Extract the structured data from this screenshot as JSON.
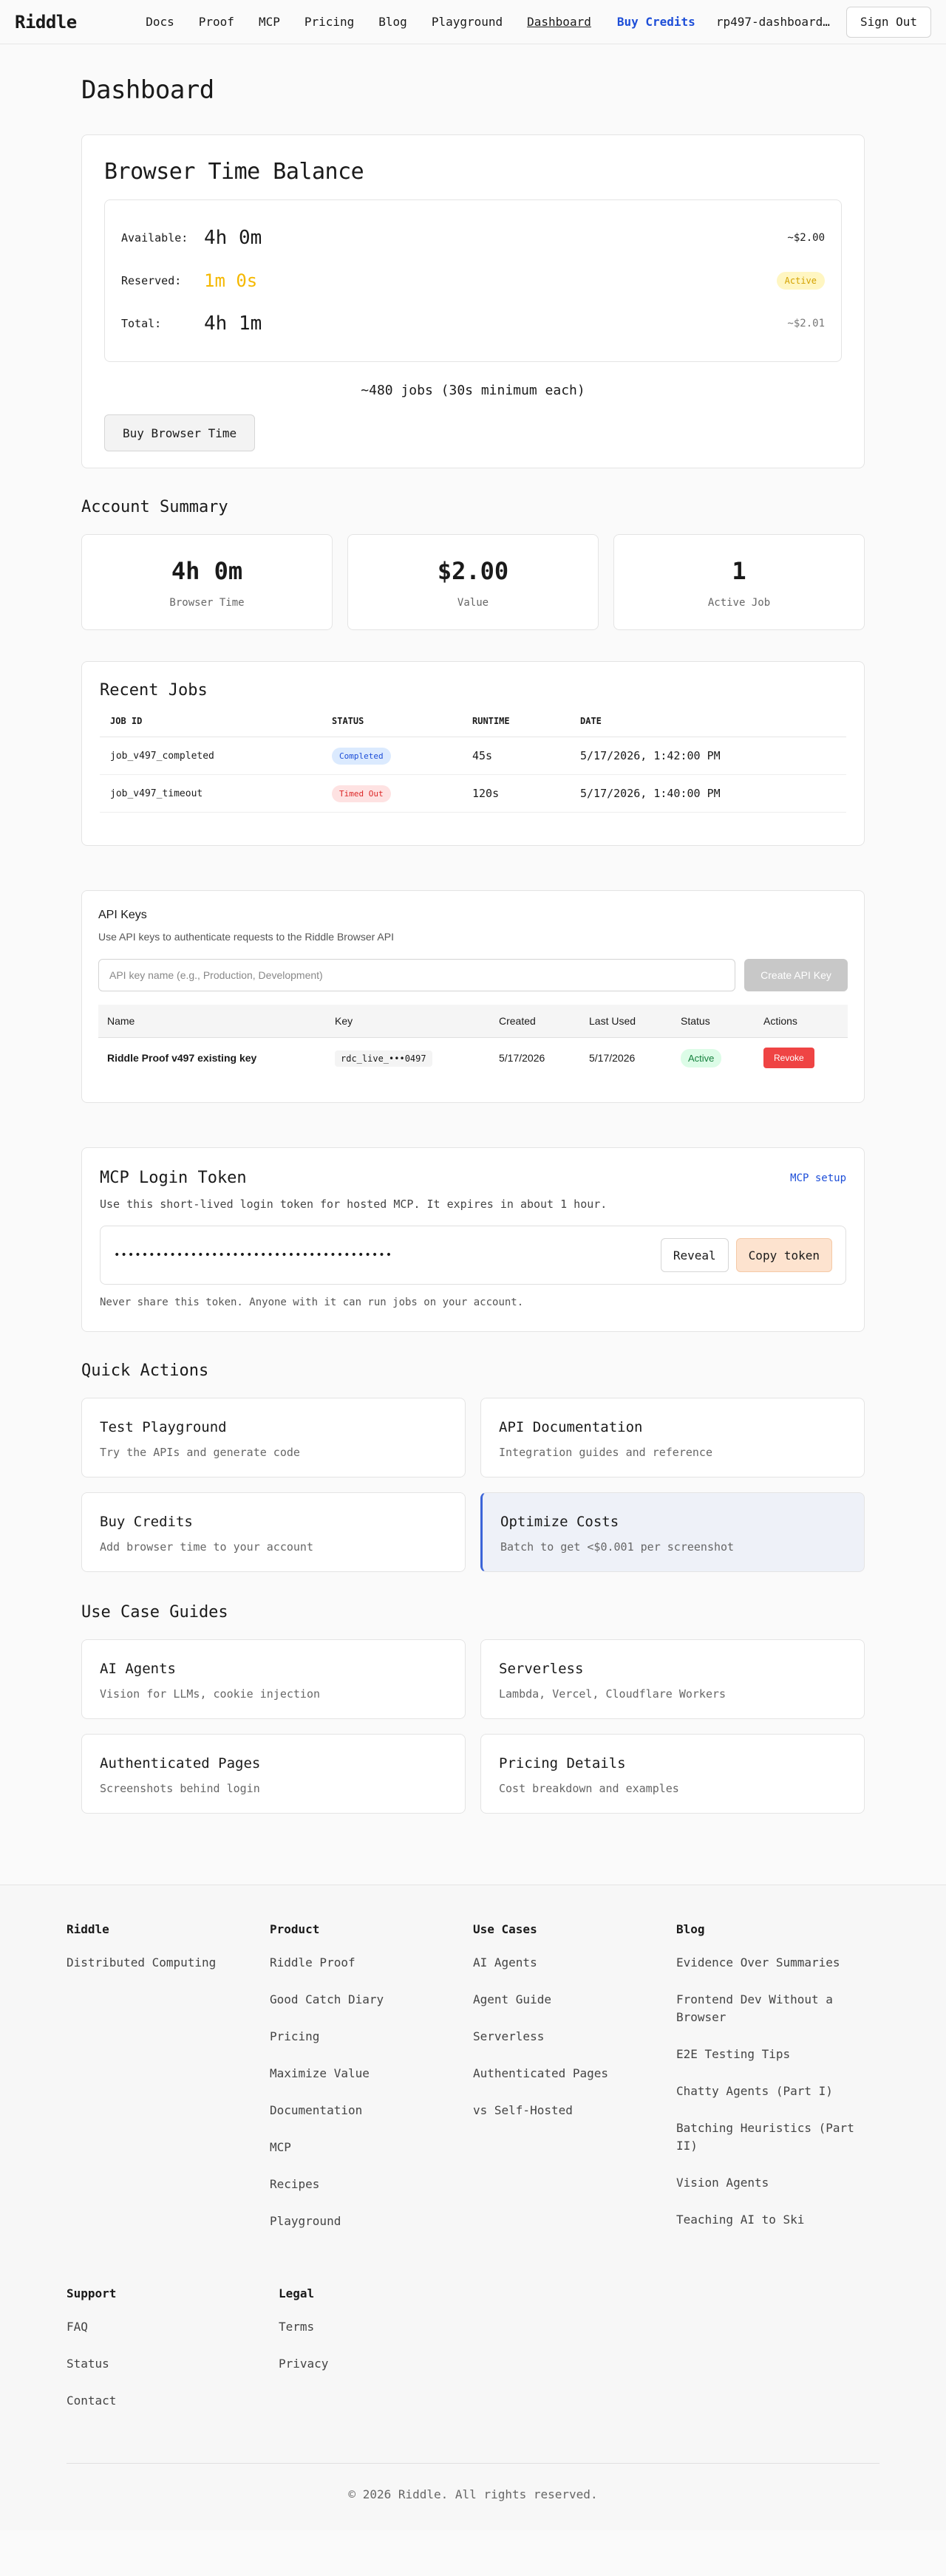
{
  "nav": {
    "brand": "Riddle",
    "links": [
      "Docs",
      "Proof",
      "MCP",
      "Pricing",
      "Blog",
      "Playground",
      "Dashboard"
    ],
    "buy_credits": "Buy Credits",
    "user": "rp497-dashboard…",
    "sign_out": "Sign Out"
  },
  "page": {
    "title": "Dashboard"
  },
  "balance": {
    "title": "Browser Time Balance",
    "available_label": "Available:",
    "available_value": "4h 0m",
    "available_money": "~$2.00",
    "reserved_label": "Reserved:",
    "reserved_value": "1m 0s",
    "reserved_badge": "Active",
    "total_label": "Total:",
    "total_value": "4h 1m",
    "total_money": "~$2.01",
    "jobs_note": "~480 jobs (30s minimum each)",
    "buy_button": "Buy Browser Time"
  },
  "summary": {
    "title": "Account Summary",
    "stats": [
      {
        "value": "4h 0m",
        "label": "Browser Time"
      },
      {
        "value": "$2.00",
        "label": "Value"
      },
      {
        "value": "1",
        "label": "Active Job"
      }
    ]
  },
  "recent_jobs": {
    "title": "Recent Jobs",
    "headers": [
      "JOB ID",
      "STATUS",
      "RUNTIME",
      "DATE"
    ],
    "rows": [
      {
        "id": "job_v497_completed",
        "status": "Completed",
        "runtime": "45s",
        "date": "5/17/2026, 1:42:00 PM"
      },
      {
        "id": "job_v497_timeout",
        "status": "Timed Out",
        "runtime": "120s",
        "date": "5/17/2026, 1:40:00 PM"
      }
    ]
  },
  "api_keys": {
    "title": "API Keys",
    "subtitle": "Use API keys to authenticate requests to the Riddle Browser API",
    "placeholder": "API key name (e.g., Production, Development)",
    "create_button": "Create API Key",
    "headers": [
      "Name",
      "Key",
      "Created",
      "Last Used",
      "Status",
      "Actions"
    ],
    "rows": [
      {
        "name": "Riddle Proof v497 existing key",
        "key": "rdc_live_•••0497",
        "created": "5/17/2026",
        "last_used": "5/17/2026",
        "status": "Active",
        "action": "Revoke"
      }
    ]
  },
  "mcp": {
    "title": "MCP Login Token",
    "setup_link": "MCP setup",
    "description": "Use this short-lived login token for hosted MCP. It expires in about 1 hour.",
    "token_masked": "••••••••••••••••••••••••••••••••••••••••",
    "reveal_button": "Reveal",
    "copy_button": "Copy token",
    "warning": "Never share this token. Anyone with it can run jobs on your account."
  },
  "quick_actions": {
    "title": "Quick Actions",
    "items": [
      {
        "title": "Test Playground",
        "desc": "Try the APIs and generate code"
      },
      {
        "title": "API Documentation",
        "desc": "Integration guides and reference"
      },
      {
        "title": "Buy Credits",
        "desc": "Add browser time to your account"
      },
      {
        "title": "Optimize Costs",
        "desc": "Batch to get <$0.001 per screenshot"
      }
    ]
  },
  "guides": {
    "title": "Use Case Guides",
    "items": [
      {
        "title": "AI Agents",
        "desc": "Vision for LLMs, cookie injection"
      },
      {
        "title": "Serverless",
        "desc": "Lambda, Vercel, Cloudflare Workers"
      },
      {
        "title": "Authenticated Pages",
        "desc": "Screenshots behind login"
      },
      {
        "title": "Pricing Details",
        "desc": "Cost breakdown and examples"
      }
    ]
  },
  "footer": {
    "columns": [
      {
        "title": "Riddle",
        "links": [
          "Distributed Computing"
        ]
      },
      {
        "title": "Product",
        "links": [
          "Riddle Proof",
          "Good Catch Diary",
          "Pricing",
          "Maximize Value",
          "Documentation",
          "MCP",
          "Recipes",
          "Playground"
        ]
      },
      {
        "title": "Use Cases",
        "links": [
          "AI Agents",
          "Agent Guide",
          "Serverless",
          "Authenticated Pages",
          "vs Self-Hosted"
        ]
      },
      {
        "title": "Blog",
        "links": [
          "Evidence Over Summaries",
          "Frontend Dev Without a Browser",
          "E2E Testing Tips",
          "Chatty Agents (Part I)",
          "Batching Heuristics (Part II)",
          "Vision Agents",
          "Teaching AI to Ski"
        ]
      }
    ],
    "columns2": [
      {
        "title": "Support",
        "links": [
          "FAQ",
          "Status",
          "Contact"
        ]
      },
      {
        "title": "Legal",
        "links": [
          "Terms",
          "Privacy"
        ]
      }
    ],
    "copyright": "© 2026 Riddle. All rights reserved."
  }
}
